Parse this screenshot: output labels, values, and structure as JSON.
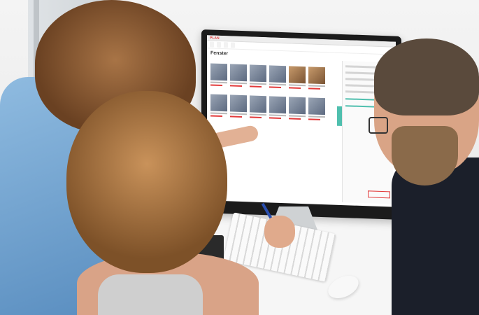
{
  "scene": {
    "description_hidden": ""
  },
  "screen_ui": {
    "logo": "PLAN",
    "heading": "Fenster",
    "product_count": 12
  }
}
